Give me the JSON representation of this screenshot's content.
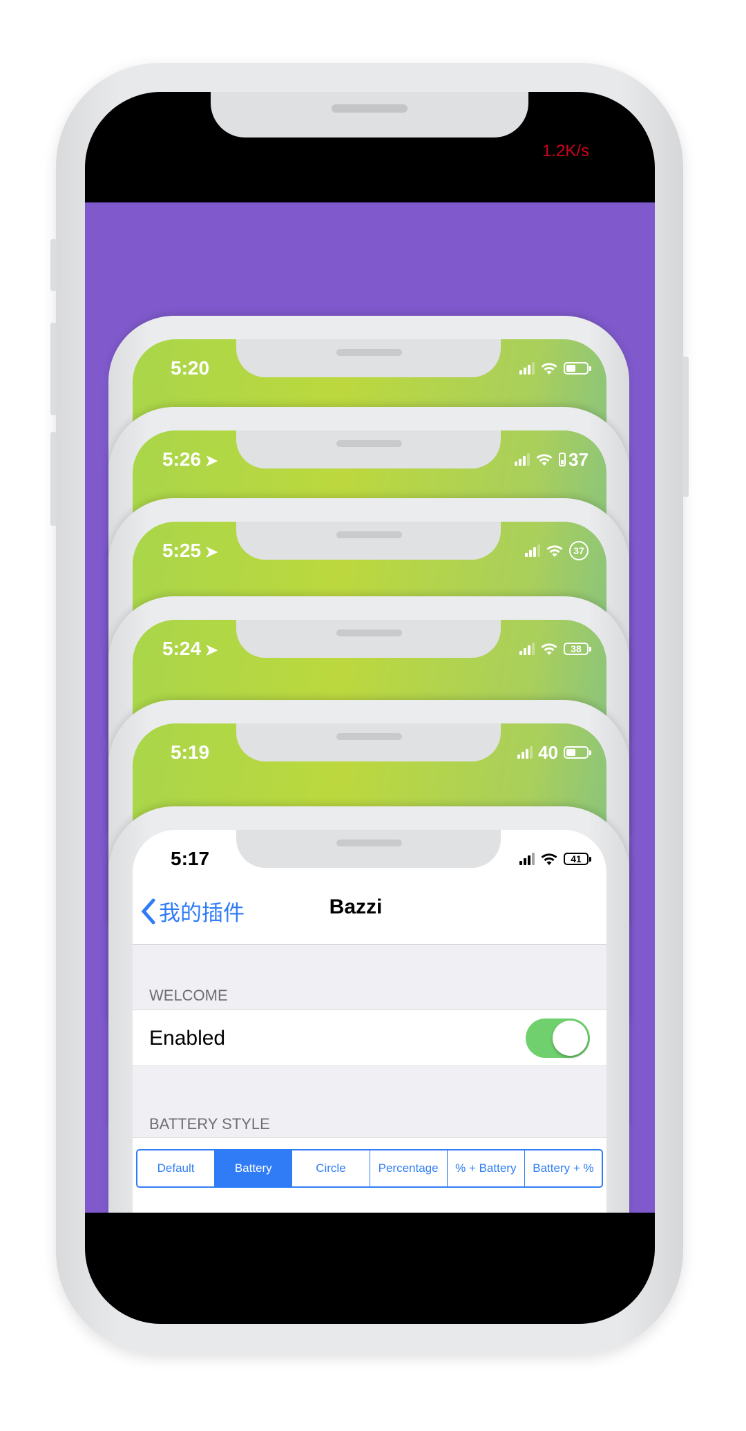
{
  "device": {
    "net_speed": "1.2K/s",
    "background_color": "#805acd",
    "speed_color": "#d0021b"
  },
  "cards": [
    {
      "time": "5:20",
      "battery_style": "battery-icon"
    },
    {
      "time": "5:26",
      "location": true,
      "battery_style": "battery-vertical-percent",
      "battery_text": "37"
    },
    {
      "time": "5:25",
      "location": true,
      "battery_style": "circle",
      "battery_text": "37"
    },
    {
      "time": "5:24",
      "location": true,
      "battery_style": "battery-with-percent",
      "battery_text": "38"
    },
    {
      "time": "5:19",
      "battery_style": "percent-battery",
      "battery_text": "40"
    }
  ],
  "settings": {
    "time": "5:17",
    "battery_text": "41",
    "back_label": "我的插件",
    "title": "Bazzi",
    "welcome_header": "WELCOME",
    "enabled_label": "Enabled",
    "enabled": true,
    "battery_style_header": "BATTERY STYLE",
    "segments": [
      "Default",
      "Battery",
      "Circle",
      "Percentage",
      "% + Battery",
      "Battery + %"
    ],
    "selected_segment": "Battery",
    "accent": "#2f7cf6",
    "toggle_color": "#6fd06d"
  }
}
